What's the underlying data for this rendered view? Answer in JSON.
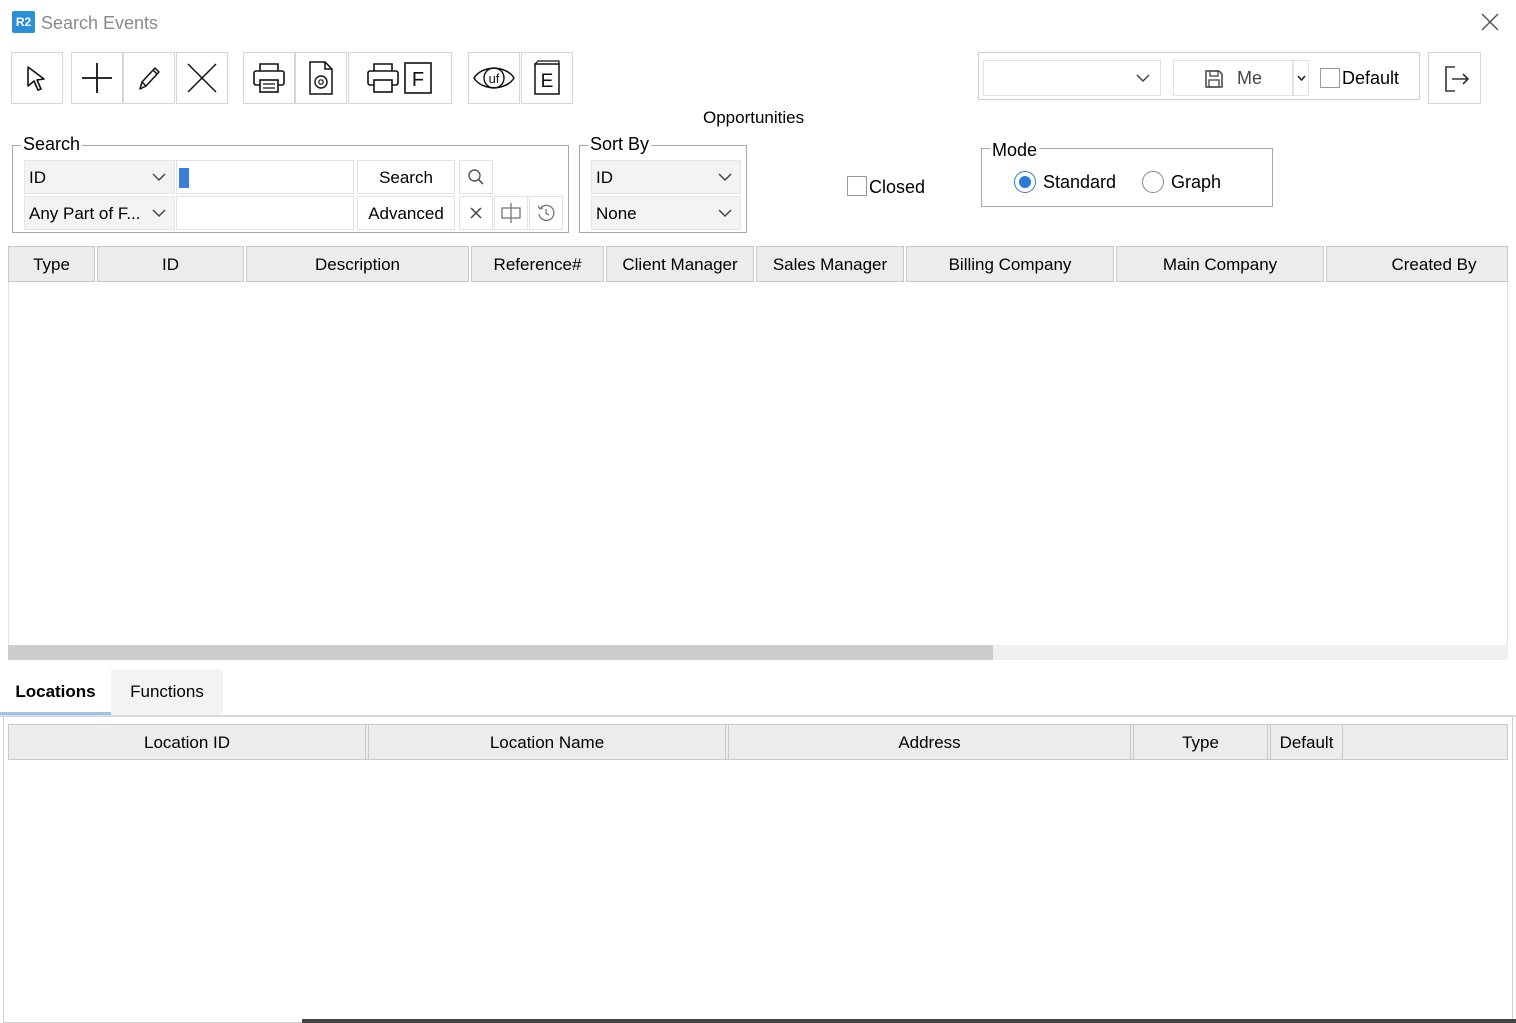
{
  "window": {
    "title": "Search Events",
    "logo_text": "R2"
  },
  "page_subtitle": "Opportunities",
  "preset": {
    "selected": "",
    "me_label": "Me",
    "default_label": "Default",
    "default_checked": false
  },
  "search": {
    "legend": "Search",
    "field_select": "ID",
    "match_select": "Any Part of F...",
    "query_value": "",
    "second_value": "",
    "search_label": "Search",
    "advanced_label": "Advanced"
  },
  "sort": {
    "legend": "Sort By",
    "primary": "ID",
    "secondary": "None"
  },
  "closed": {
    "label": "Closed",
    "checked": false
  },
  "mode": {
    "legend": "Mode",
    "options": [
      "Standard",
      "Graph"
    ],
    "selected": "Standard"
  },
  "results_grid": {
    "columns": [
      "Type",
      "ID",
      "Description",
      "Reference#",
      "Client Manager",
      "Sales Manager",
      "Billing Company",
      "Main Company",
      "Created By"
    ],
    "rows": []
  },
  "tabs": [
    {
      "label": "Locations",
      "active": true
    },
    {
      "label": "Functions",
      "active": false
    }
  ],
  "locations_grid": {
    "columns": [
      "Location ID",
      "Location Name",
      "Address",
      "Type",
      "Default"
    ],
    "rows": []
  }
}
